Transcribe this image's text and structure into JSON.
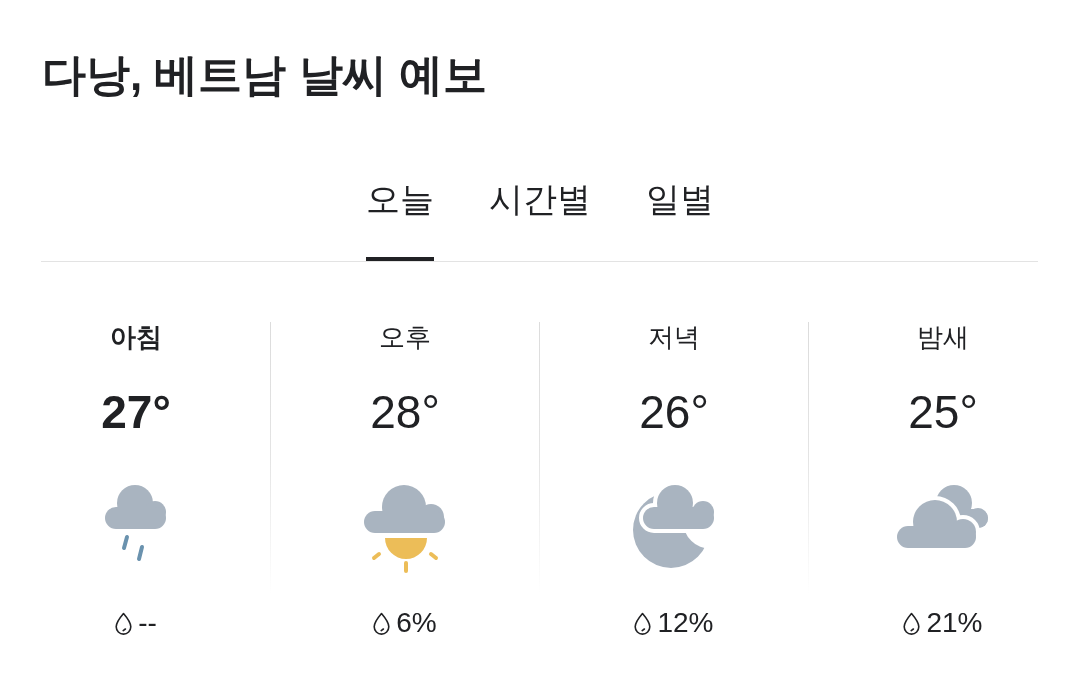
{
  "title": "다낭, 베트남 날씨 예보",
  "tabs": [
    {
      "label": "오늘",
      "selected": true
    },
    {
      "label": "시간별",
      "selected": false
    },
    {
      "label": "일별",
      "selected": false
    }
  ],
  "periods": [
    {
      "label": "아침",
      "temperature": "27°",
      "kind": "rain",
      "precipitation": "--",
      "selected": true
    },
    {
      "label": "오후",
      "temperature": "28°",
      "kind": "cloud-sun",
      "precipitation": "6%",
      "selected": false
    },
    {
      "label": "저녁",
      "temperature": "26°",
      "kind": "cloud-moon",
      "precipitation": "12%",
      "selected": false
    },
    {
      "label": "밤새",
      "temperature": "25°",
      "kind": "clouds",
      "precipitation": "21%",
      "selected": false
    }
  ]
}
